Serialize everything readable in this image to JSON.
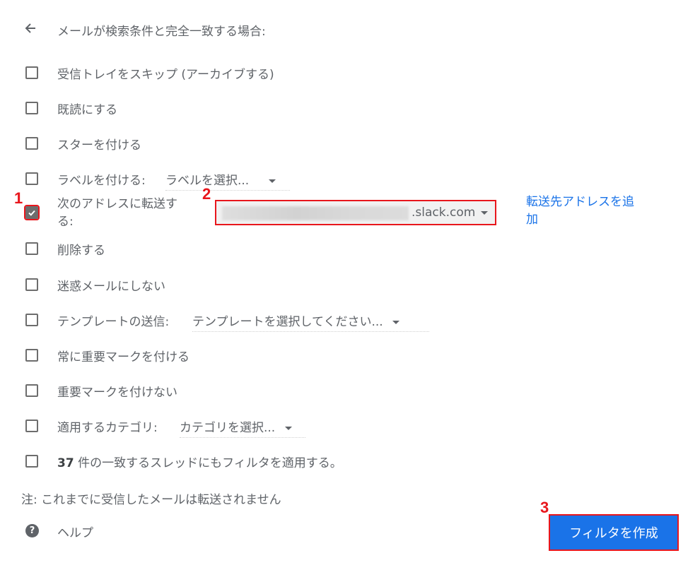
{
  "header": {
    "back_icon": "arrow-left-icon",
    "title": "メールが検索条件と完全一致する場合:"
  },
  "options": [
    {
      "label": "受信トレイをスキップ (アーカイブする)",
      "checked": false
    },
    {
      "label": "既読にする",
      "checked": false
    },
    {
      "label": "スターを付ける",
      "checked": false
    },
    {
      "label": "ラベルを付ける:",
      "checked": false,
      "select": "ラベルを選択..."
    },
    {
      "label_line1": "次のアドレスに転送す",
      "label_line2": "る:",
      "checked": true
    },
    {
      "label": "削除する",
      "checked": false
    },
    {
      "label": "迷惑メールにしない",
      "checked": false
    },
    {
      "label": "テンプレートの送信:",
      "checked": false,
      "select": "テンプレートを選択してください..."
    },
    {
      "label": "常に重要マークを付ける",
      "checked": false
    },
    {
      "label": "重要マークを付けない",
      "checked": false
    },
    {
      "label": "適用するカテゴリ:",
      "checked": false,
      "select": "カテゴリを選択..."
    },
    {
      "count": "37",
      "label": " 件の一致するスレッドにもフィルタを適用する。",
      "checked": false
    }
  ],
  "forward": {
    "address_suffix": ".slack.com",
    "add_link_line1": "転送先アドレスを追",
    "add_link_line2": "加"
  },
  "note": "注: これまでに受信したメールは転送されません",
  "help": {
    "icon": "help-circle-icon",
    "label": "ヘルプ"
  },
  "create_button": "フィルタを作成",
  "annotations": [
    "1",
    "2",
    "3"
  ],
  "colors": {
    "accent": "#1a73e8",
    "annotation": "#e8161c",
    "text": "#5f6368"
  }
}
